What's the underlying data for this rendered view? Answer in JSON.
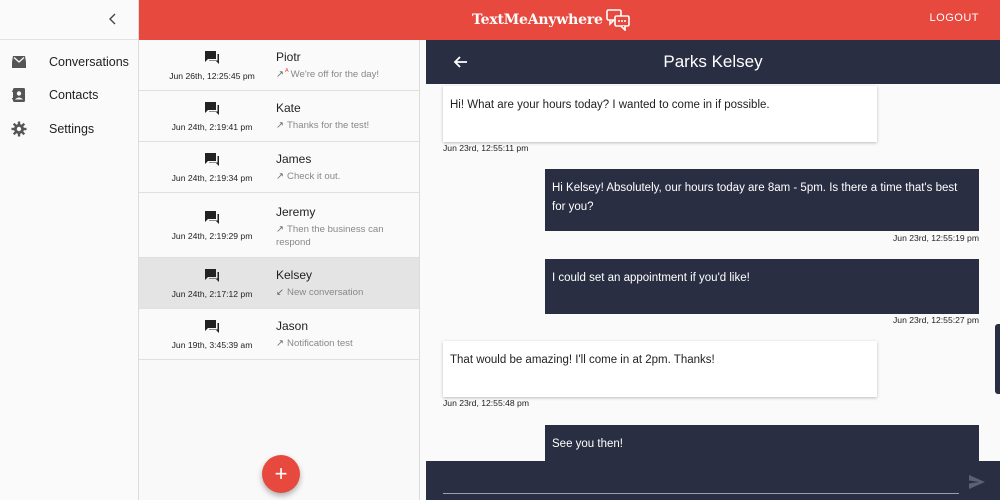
{
  "app": {
    "brand": "TextMeAnywhere",
    "logout_label": "LOGOUT",
    "colors": {
      "brand_red": "#e8493e",
      "navy": "#2a2e42"
    }
  },
  "sidebar": {
    "collapse_icon": "chevron-left-icon",
    "items": [
      {
        "label": "Conversations",
        "icon": "inbox-icon"
      },
      {
        "label": "Contacts",
        "icon": "contacts-icon"
      },
      {
        "label": "Settings",
        "icon": "gear-icon"
      }
    ]
  },
  "conversations": [
    {
      "name": "Piotr",
      "time": "Jun 26th, 12:25:45 pm",
      "preview": "We're off for the day!",
      "direction": "outgoing-auto"
    },
    {
      "name": "Kate",
      "time": "Jun 24th, 2:19:41 pm",
      "preview": "Thanks for the test!",
      "direction": "outgoing"
    },
    {
      "name": "James",
      "time": "Jun 24th, 2:19:34 pm",
      "preview": "Check it out.",
      "direction": "outgoing"
    },
    {
      "name": "Jeremy",
      "time": "Jun 24th, 2:19:29 pm",
      "preview": "Then the business can respond",
      "direction": "outgoing"
    },
    {
      "name": "Kelsey",
      "time": "Jun 24th, 2:17:12 pm",
      "preview": "New conversation",
      "direction": "incoming",
      "selected": true
    },
    {
      "name": "Jason",
      "time": "Jun 19th, 3:45:39 am",
      "preview": "Notification test",
      "direction": "outgoing"
    }
  ],
  "new_conversation_label": "+",
  "chat": {
    "title": "Parks Kelsey",
    "messages": [
      {
        "type": "in",
        "text": "Hi! What are your hours today? I wanted to come in if possible.",
        "time": "Jun 23rd, 12:55:11 pm"
      },
      {
        "type": "out",
        "text": "Hi Kelsey! Absolutely, our hours today are 8am - 5pm. Is there a time that's best for you?",
        "time": "Jun 23rd, 12:55:19 pm"
      },
      {
        "type": "out",
        "text": "I could set an appointment if you'd like!",
        "time": "Jun 23rd, 12:55:27 pm"
      },
      {
        "type": "in",
        "text": "That would be amazing! I'll come in at 2pm. Thanks!",
        "time": "Jun 23rd, 12:55:48 pm"
      },
      {
        "type": "out",
        "text": "See you then!",
        "time": ""
      }
    ],
    "compose_value": "",
    "compose_placeholder": ""
  }
}
